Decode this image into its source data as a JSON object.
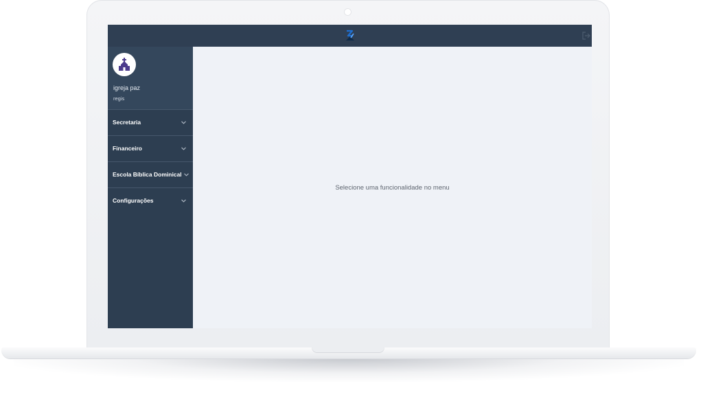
{
  "app": {
    "logo_icon": "brand-logo-icon",
    "logout_icon": "logout-icon"
  },
  "profile": {
    "org_name": "igreja paz",
    "user_name": "regis",
    "avatar_icon": "church-icon"
  },
  "sidebar": {
    "items": [
      {
        "label": "Secretaria",
        "icon": "chevron-down-icon"
      },
      {
        "label": "Financeiro",
        "icon": "chevron-down-icon"
      },
      {
        "label": "Escola Bíblica Dominical",
        "icon": "chevron-down-icon"
      },
      {
        "label": "Configurações",
        "icon": "chevron-down-icon"
      }
    ]
  },
  "main": {
    "empty_message": "Selecione uma funcionalidade no menu"
  },
  "colors": {
    "topbar": "#2f3f53",
    "sidebar": "#2d3e51",
    "profile_panel": "#34475c",
    "content_bg": "#eff2f7",
    "avatar_icon": "#4b3a8c"
  }
}
